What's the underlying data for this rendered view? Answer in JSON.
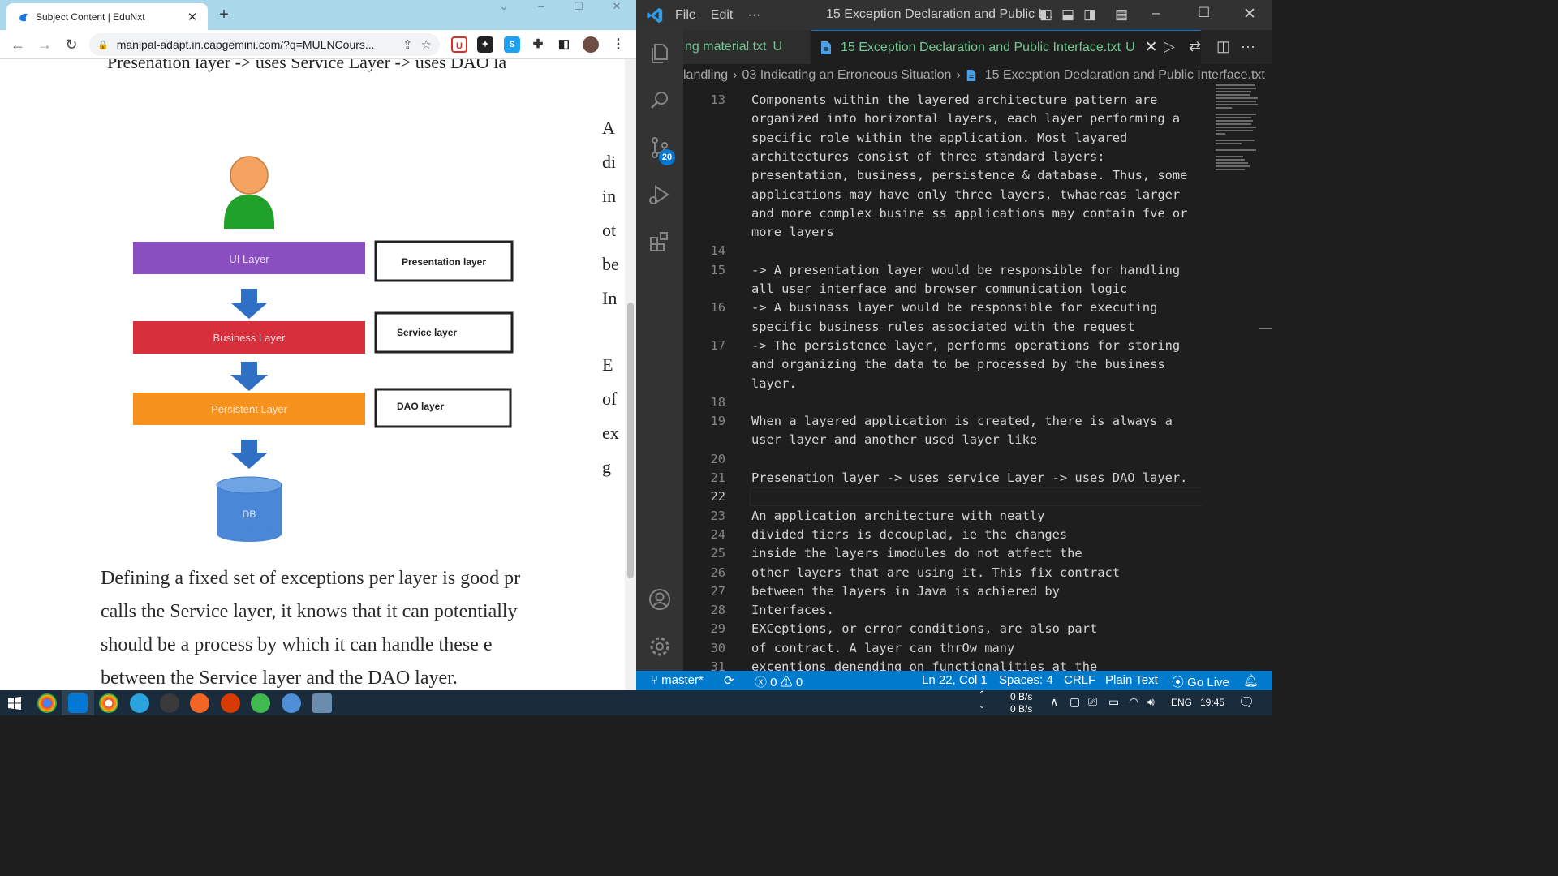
{
  "browser": {
    "tab_title": "Subject Content | EduNxt",
    "tab_close": "✕",
    "new_tab": "+",
    "url": "manipal-adapt.in.capgemini.com/?q=MULNCours...",
    "page": {
      "cut_heading": "Presenation layer -> uses Service Layer -> uses DAO la",
      "side_fragments": [
        "A",
        "di",
        "in",
        "ot",
        "be",
        "In",
        "E",
        "of",
        "ex",
        "g"
      ],
      "diagram": {
        "ui_layer": "UI Layer",
        "business_layer": "Business Layer",
        "persistent_layer": "Persistent Layer",
        "db": "DB",
        "presentation_box": "Presentation layer",
        "service_box": "Service layer",
        "dao_box": "DAO layer"
      },
      "bottom_lines": [
        "Defining a fixed set of exceptions per layer is good pr",
        "calls the Service layer, it knows that it can potentially",
        "should be a process by which it can handle these e",
        "between the Service layer and the DAO layer."
      ]
    }
  },
  "vscode": {
    "menu": [
      "File",
      "Edit",
      "···"
    ],
    "window_title": "15 Exception Declaration and Public I...",
    "tabs": [
      {
        "label": "ng material.txt",
        "status": "U"
      },
      {
        "label": "15 Exception Declaration and Public Interface.txt",
        "status": "U"
      }
    ],
    "breadcrumb": [
      "landling",
      "03 Indicating an Erroneous Situation",
      "15 Exception Declaration and Public Interface.txt"
    ],
    "scm_badge": "20",
    "lines": [
      {
        "n": "13",
        "text": "Components within the layered architecture pattern are"
      },
      {
        "n": "",
        "text": "organized into horizontal layers, each layer performing a"
      },
      {
        "n": "",
        "text": "specific role within the application. Most layared"
      },
      {
        "n": "",
        "text": "architectures consist of three standard layers:"
      },
      {
        "n": "",
        "text": "presentation, business, persistence & database. Thus, some"
      },
      {
        "n": "",
        "text": "applications may have only three layers, twhaereas larger"
      },
      {
        "n": "",
        "text": "and more complex busine ss applications may contain fve or"
      },
      {
        "n": "",
        "text": "more layers"
      },
      {
        "n": "14",
        "text": ""
      },
      {
        "n": "15",
        "text": "-> A presentation layer would be responsible for handling"
      },
      {
        "n": "",
        "text": "all user interface and browser communication logic"
      },
      {
        "n": "16",
        "text": "-> A businass layer would be responsible for executing"
      },
      {
        "n": "",
        "text": "specific business rules associated with the request"
      },
      {
        "n": "17",
        "text": "-> The persistence layer, performs operations for storing"
      },
      {
        "n": "",
        "text": "and organizing the data to be processed by the business"
      },
      {
        "n": "",
        "text": "layer."
      },
      {
        "n": "18",
        "text": ""
      },
      {
        "n": "19",
        "text": "When a layered application is created, there is always a"
      },
      {
        "n": "",
        "text": "user layer and another used layer like"
      },
      {
        "n": "20",
        "text": ""
      },
      {
        "n": "21",
        "text": "Presenation layer -> uses service Layer -> uses DAO layer."
      },
      {
        "n": "22",
        "text": ""
      },
      {
        "n": "23",
        "text": "An application architecture with neatly"
      },
      {
        "n": "24",
        "text": "divided tiers is decouplad, ie the changes"
      },
      {
        "n": "25",
        "text": "inside the layers imodules do not atfect the"
      },
      {
        "n": "26",
        "text": "other layers that are using it. This fix contract"
      },
      {
        "n": "27",
        "text": "between the layers in Java is achiered by"
      },
      {
        "n": "28",
        "text": "Interfaces."
      },
      {
        "n": "29",
        "text": "EXCeptions, or error conditions, are also part"
      },
      {
        "n": "30",
        "text": "of contract. A layer can thrOw many"
      },
      {
        "n": "31",
        "text": "excentions denending on functionalities at the"
      }
    ],
    "active_line": "22",
    "status": {
      "branch": "master*",
      "errors": "0",
      "warnings": "0",
      "position": "Ln 22, Col 1",
      "spaces": "Spaces: 4",
      "eol": "CRLF",
      "language": "Plain Text",
      "golive": "Go Live"
    }
  },
  "taskbar": {
    "net_up": "0 B/s",
    "net_down": "0 B/s",
    "lang": "ENG",
    "time": "19:45"
  }
}
